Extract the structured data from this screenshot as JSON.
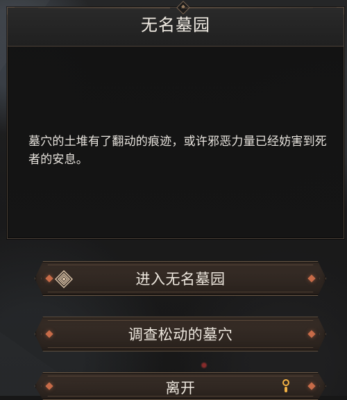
{
  "dialog": {
    "title": "无名墓园",
    "description": "墓穴的土堆有了翻动的痕迹，或许邪恶力量已经妨害到死者的安息。"
  },
  "choices": [
    {
      "label": "进入无名墓园",
      "icon": "entry-sigil-icon"
    },
    {
      "label": "调查松动的墓穴"
    },
    {
      "label": "离开"
    }
  ],
  "colors": {
    "panel_border": "#4c4137",
    "choice_border": "#6a5846",
    "accent": "#c76b48",
    "text": "#eee8df"
  }
}
